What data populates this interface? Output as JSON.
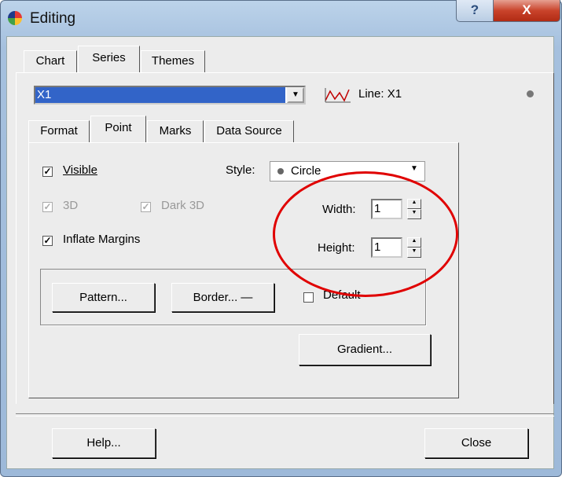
{
  "window": {
    "title": "Editing",
    "help_glyph": "?",
    "close_glyph": "X"
  },
  "top_tabs": [
    "Chart",
    "Series",
    "Themes"
  ],
  "series_select": {
    "value": "X1",
    "series_label": "Line: X1"
  },
  "sub_tabs": [
    "Format",
    "Point",
    "Marks",
    "Data Source"
  ],
  "point": {
    "visible_label": "Visible",
    "visible_checked": true,
    "threed_label": "3D",
    "threed_checked": true,
    "dark3d_label": "Dark 3D",
    "dark3d_checked": true,
    "inflate_label": "Inflate Margins",
    "inflate_checked": true,
    "style_label": "Style:",
    "style_value": "Circle",
    "width_label": "Width:",
    "width_value": "1",
    "height_label": "Height:",
    "height_value": "1",
    "pattern_button": "Pattern...",
    "border_button": "Border...",
    "default_label": "Default",
    "default_checked": false,
    "gradient_button": "Gradient..."
  },
  "footer": {
    "help_button": "Help...",
    "close_button": "Close"
  },
  "check_glyph": "✓",
  "colors": {
    "selection": "#3264c8",
    "annotation": "#e00000"
  }
}
